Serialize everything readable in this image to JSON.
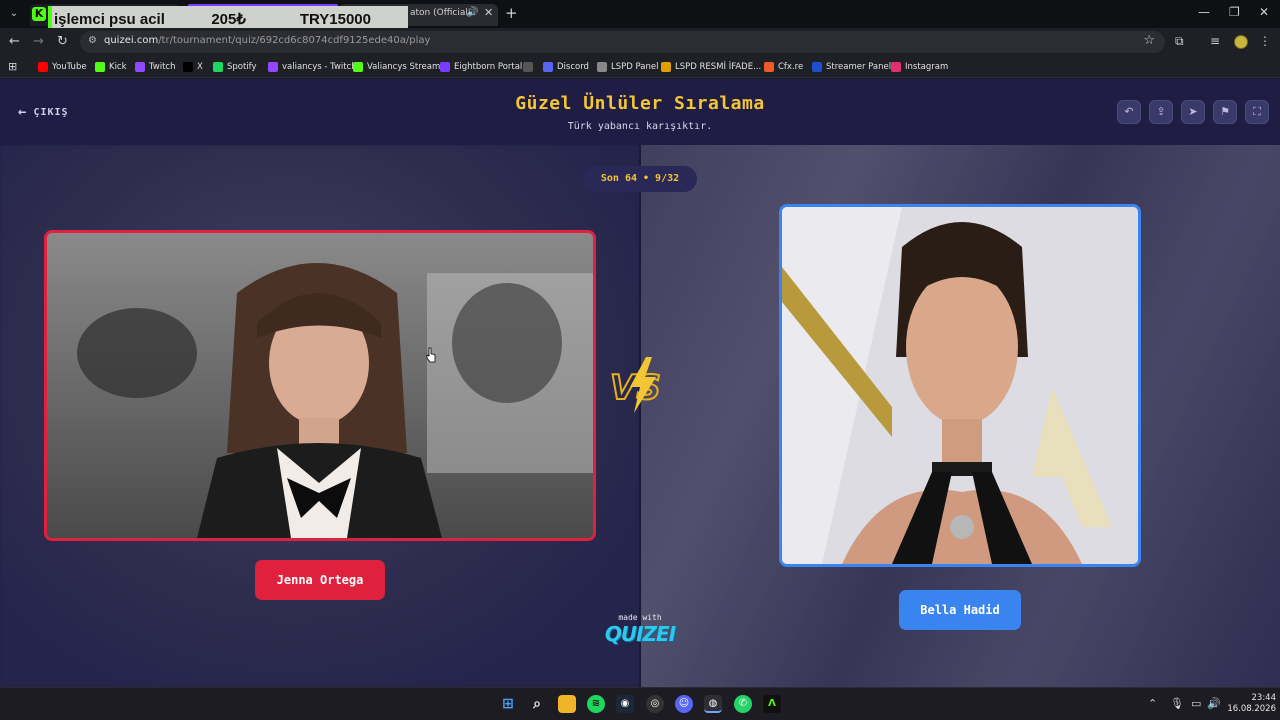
{
  "browser": {
    "overlay": {
      "text1": "işlemci psu acil",
      "text2": "205₺",
      "text3": "TRY15000"
    },
    "active_tab_title": "aton (Official V",
    "url_host": "quizei.com",
    "url_path": "/tr/tournament/quiz/692cd6c8074cdf9125ede40a/play",
    "bookmarks": [
      {
        "label": "YouTube",
        "color": "#ff0000"
      },
      {
        "label": "Kick",
        "color": "#53fc18"
      },
      {
        "label": "Twitch",
        "color": "#9146ff"
      },
      {
        "label": "X",
        "color": "#000000"
      },
      {
        "label": "Spotify",
        "color": "#1ed760"
      },
      {
        "label": "valiancys - Twitch",
        "color": "#9146ff"
      },
      {
        "label": "Valiancys Stream",
        "color": "#53fc18"
      },
      {
        "label": "Eightborn Portal",
        "color": "#7a3cff"
      },
      {
        "label": "",
        "color": "#555555"
      },
      {
        "label": "Discord",
        "color": "#5865f2"
      },
      {
        "label": "LSPD Panel",
        "color": "#888888"
      },
      {
        "label": "LSPD  RESMİ İFADE...",
        "color": "#e0a000"
      },
      {
        "label": "Cfx.re",
        "color": "#f05a24"
      },
      {
        "label": "Streamer Panel",
        "color": "#1e4fd0"
      },
      {
        "label": "Instagram",
        "color": "#e1306c"
      }
    ]
  },
  "page": {
    "exit_label": "ÇIKIŞ",
    "title": "Güzel Ünlüler Sıralama",
    "subtitle": "Türk yabancı karışıktır.",
    "round": "Son 64 • 9/32",
    "left_name": "Jenna Ortega",
    "right_name": "Bella Hadid",
    "vs": "VS",
    "made_with": "made with",
    "brand": "QUIZEI",
    "colors": {
      "accent": "#f4c534",
      "left": "#e0213e",
      "right": "#3a84f0",
      "brand": "#2ec7f0"
    }
  },
  "taskbar": {
    "time": "23:44",
    "date": "16.08.2026"
  }
}
